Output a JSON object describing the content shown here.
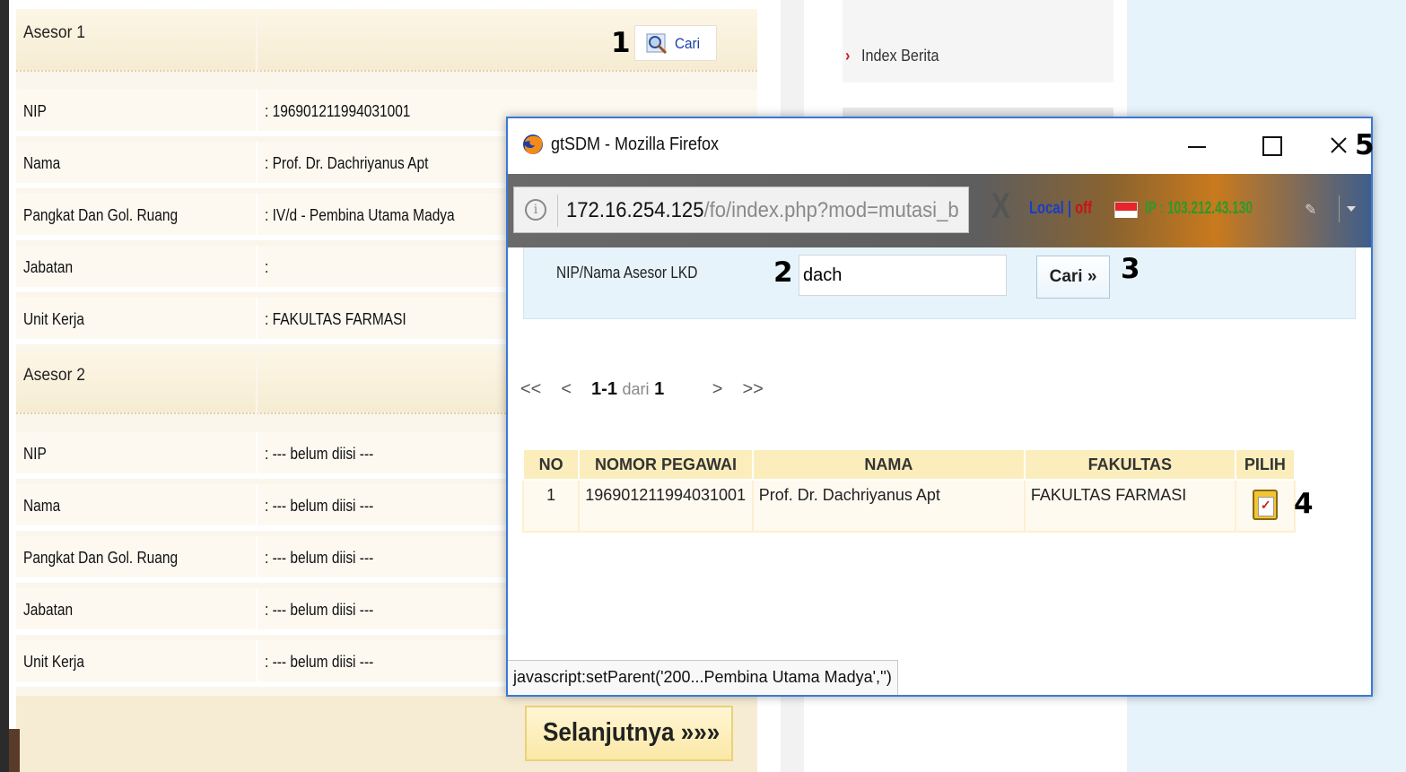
{
  "form": {
    "asesor1": {
      "title": "Asesor 1",
      "search_button": "Cari",
      "rows": [
        {
          "label": "NIP",
          "value": ": 196901211994031001"
        },
        {
          "label": "Nama",
          "value": ": Prof. Dr. Dachriyanus Apt"
        },
        {
          "label": "Pangkat Dan Gol. Ruang",
          "value": ": IV/d - Pembina Utama Madya"
        },
        {
          "label": "Jabatan",
          "value": ":"
        },
        {
          "label": "Unit Kerja",
          "value": ": FAKULTAS FARMASI"
        }
      ]
    },
    "asesor2": {
      "title": "Asesor 2",
      "rows": [
        {
          "label": "NIP",
          "value": ": --- belum diisi ---"
        },
        {
          "label": "Nama",
          "value": ": --- belum diisi ---"
        },
        {
          "label": "Pangkat Dan Gol. Ruang",
          "value": ": --- belum diisi ---"
        },
        {
          "label": "Jabatan",
          "value": ": --- belum diisi ---"
        },
        {
          "label": "Unit Kerja",
          "value": ": --- belum diisi ---"
        }
      ]
    },
    "next_button": "Selanjutnya »»»"
  },
  "sidebar": {
    "link": "Index Berita"
  },
  "annotations": {
    "a1": "1",
    "a2": "2",
    "a3": "3",
    "a4": "4",
    "a5": "5"
  },
  "popup": {
    "title": "gtSDM - Mozilla Firefox",
    "url_host": "172.16.254.125",
    "url_path": "/fo/index.php?mod=mutasi_b",
    "clear": "X",
    "local_a": "Local | ",
    "local_b": "off",
    "ip": "IP : 103.212.43.130",
    "search": {
      "label": "NIP/Nama Asesor LKD",
      "value": "dach",
      "button": "Cari »"
    },
    "pager": {
      "first": "<<",
      "prev": "<",
      "range": "1-1",
      "dari": "dari",
      "total": "1",
      "next": ">",
      "last": ">>"
    },
    "table": {
      "headers": [
        "NO",
        "NOMOR PEGAWAI",
        "NAMA",
        "FAKULTAS",
        "PILIH"
      ],
      "rows": [
        {
          "no": "1",
          "nip": "196901211994031001",
          "nama": "Prof. Dr. Dachriyanus Apt",
          "fakultas": "FAKULTAS FARMASI"
        }
      ]
    },
    "status": "javascript:setParent('200...Pembina Utama Madya','')"
  },
  "colors": {
    "accent_blue": "#3a78d8",
    "form_bg": "#fbf6ec",
    "header_yellow": "#fbeebc",
    "link_red": "#d4161e"
  },
  "icons": {
    "search": "magnifier-icon",
    "firefox": "firefox-icon",
    "info": "info-icon",
    "pick": "clipboard-check-icon"
  }
}
